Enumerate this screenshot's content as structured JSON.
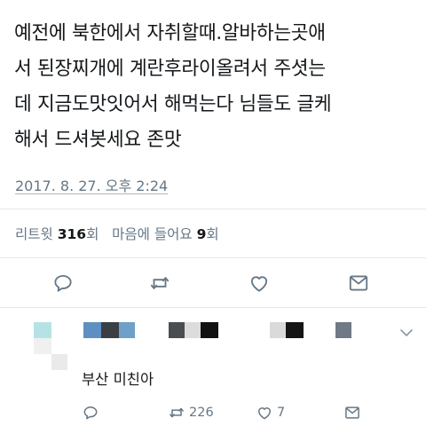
{
  "tweet": {
    "lines": [
      "예전에 북한에서 자취할때.알바하는곳애",
      "서 된장찌개에 계란후라이올려서 주셧는",
      "데 지금도맛잇어서 해먹는다 님들도 글케",
      "해서 드셔봇세요 존맛"
    ],
    "timestamp": "2017. 8. 27. 오후 2:24",
    "stats": {
      "retweets_label": "리트윗",
      "retweets_count": "316",
      "retweets_unit": "회",
      "likes_label": "마음에 들어요",
      "likes_count": "9",
      "likes_unit": "회"
    },
    "icons": {
      "reply": "reply-icon",
      "retweet": "retweet-icon",
      "like": "heart-icon",
      "share": "share-icon"
    }
  },
  "reply": {
    "text": "부산 미친아",
    "retweet_count": "226",
    "like_count": "7",
    "icons": {
      "reply": "reply-icon",
      "retweet": "retweet-icon",
      "like": "heart-icon",
      "share": "share-icon",
      "menu": "chevron-down-icon"
    }
  },
  "colors": {
    "text": "#14171a",
    "muted": "#657786",
    "icon": "#657786",
    "divider": "#e1e8ed"
  }
}
